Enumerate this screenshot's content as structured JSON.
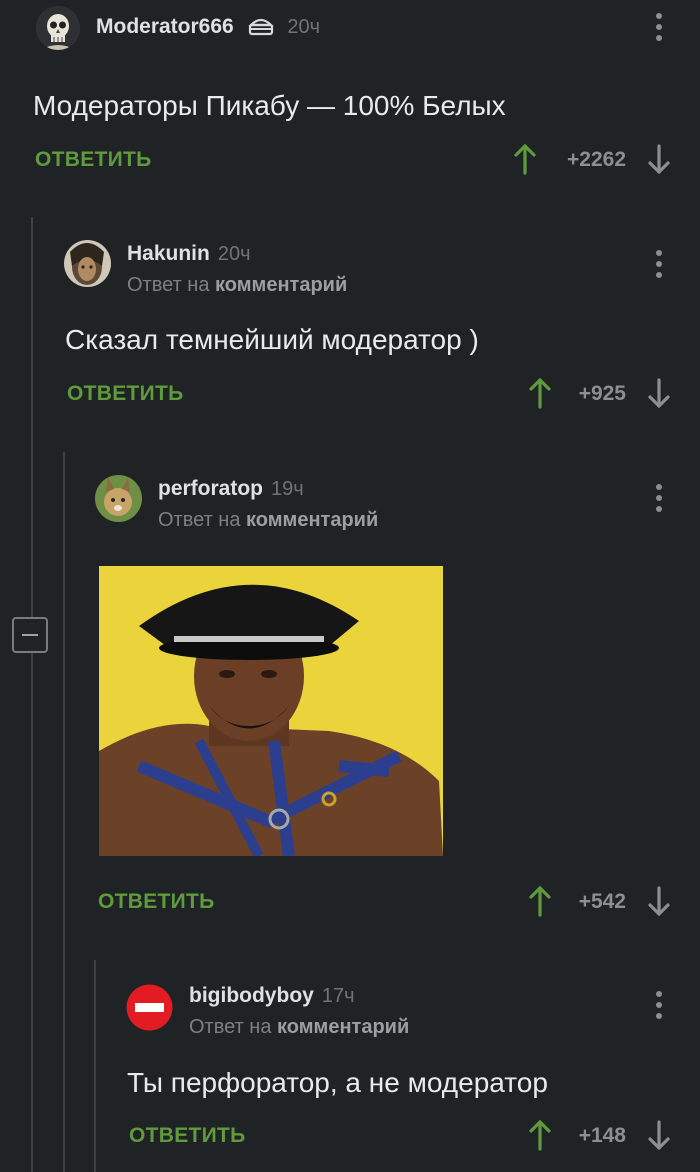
{
  "comments": [
    {
      "username": "Moderator666",
      "time": "20ч",
      "text": "Модераторы Пикабу  — 100% Белых",
      "reply_label": "ОТВЕТИТЬ",
      "rating": "+2262",
      "avatar_icon": "skull-avatar-icon",
      "badge_icon": "moderator-cake-icon"
    },
    {
      "username": "Hakunin",
      "time": "20ч",
      "reply_prefix": "Ответ на",
      "reply_target": "комментарий",
      "text": "Сказал темнейший модератор )",
      "reply_label": "ОТВЕТИТЬ",
      "rating": "+925"
    },
    {
      "username": "perforatop",
      "time": "19ч",
      "reply_prefix": "Ответ на",
      "reply_target": "комментарий",
      "reply_label": "ОТВЕТИТЬ",
      "rating": "+542",
      "image_description_icon": "comment-photo"
    },
    {
      "username": "bigibodyboy",
      "time": "17ч",
      "reply_prefix": "Ответ на",
      "reply_target": "комментарий",
      "text": "Ты перфоратор, а не модератор",
      "reply_label": "ОТВЕТИТЬ",
      "rating": "+148",
      "avatar_icon": "no-entry-avatar-icon"
    }
  ],
  "colors": {
    "background": "#202325",
    "reply": "#5f9a3c",
    "upvote": "#5f9a3c",
    "muted": "#8a8f93"
  }
}
